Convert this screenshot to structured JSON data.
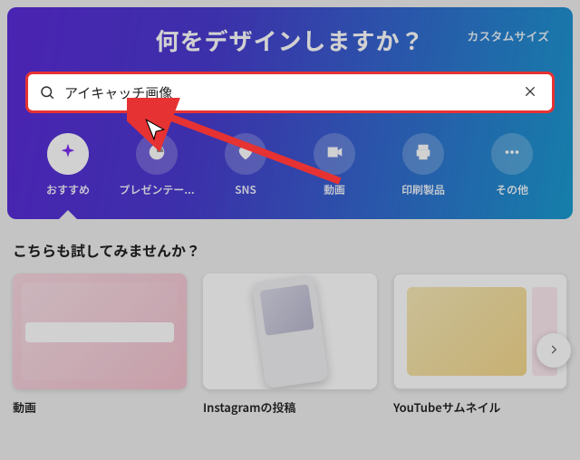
{
  "hero": {
    "title": "何をデザインしますか？",
    "custom_size": "カスタムサイズ"
  },
  "search": {
    "value": "アイキャッチ画像"
  },
  "categories": [
    {
      "id": "recommended",
      "label": "おすすめ",
      "icon": "sparkle",
      "active": true
    },
    {
      "id": "presentation",
      "label": "プレゼンテー...",
      "icon": "chart",
      "active": false
    },
    {
      "id": "sns",
      "label": "SNS",
      "icon": "heart",
      "active": false
    },
    {
      "id": "video",
      "label": "動画",
      "icon": "video",
      "active": false
    },
    {
      "id": "print",
      "label": "印刷製品",
      "icon": "printer",
      "active": false
    },
    {
      "id": "more",
      "label": "その他",
      "icon": "dots",
      "active": false
    }
  ],
  "suggestions": {
    "title": "こちらも試してみませんか？",
    "items": [
      {
        "id": "video",
        "label": "動画",
        "thumb": "t1"
      },
      {
        "id": "instagram",
        "label": "Instagramの投稿",
        "thumb": "t2"
      },
      {
        "id": "youtube",
        "label": "YouTubeサムネイル",
        "thumb": "t3"
      }
    ]
  }
}
